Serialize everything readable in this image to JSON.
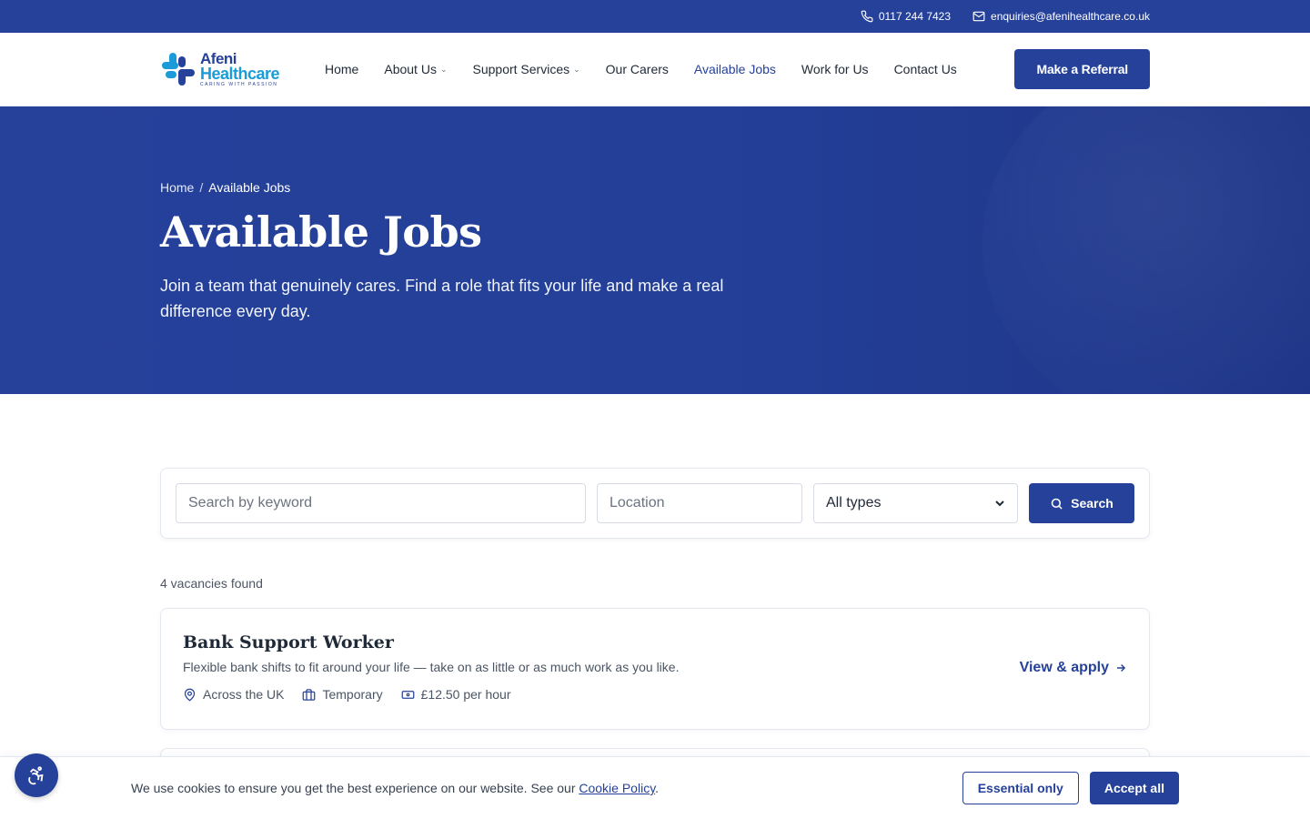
{
  "topbar": {
    "phone": "0117 244 7423",
    "email": "enquiries@afenihealthcare.co.uk"
  },
  "logo": {
    "name_line1": "Afeni",
    "name_line2": "Healthcare",
    "tagline": "CARING WITH PASSION"
  },
  "nav": {
    "items": [
      {
        "label": "Home"
      },
      {
        "label": "About Us"
      },
      {
        "label": "Support Services"
      },
      {
        "label": "Our Carers"
      },
      {
        "label": "Available Jobs"
      },
      {
        "label": "Work for Us"
      },
      {
        "label": "Contact Us"
      }
    ],
    "cta": "Make a Referral"
  },
  "hero": {
    "breadcrumb": {
      "home": "Home",
      "sep": "/",
      "current": "Available Jobs"
    },
    "title": "Available Jobs",
    "subtitle": "Join a team that genuinely cares. Find a role that fits your life and make a real difference every day."
  },
  "search": {
    "keyword_placeholder": "Search by keyword",
    "location_placeholder": "Location",
    "type_selected": "All types",
    "button": "Search"
  },
  "results": {
    "count_text": "4 vacancies found",
    "jobs": [
      {
        "title": "Bank Support Worker",
        "description": "Flexible bank shifts to fit around your life — take on as little or as much work as you like.",
        "location": "Across the UK",
        "type": "Temporary",
        "pay": "£12.50 per hour",
        "apply": "View & apply"
      }
    ]
  },
  "cookie": {
    "text": "We use cookies to ensure you get the best experience on our website. See our ",
    "link": "Cookie Policy",
    "end": ".",
    "essential": "Essential only",
    "accept": "Accept all"
  },
  "colors": {
    "brand": "#26419a",
    "accent": "#1b9bd7"
  }
}
